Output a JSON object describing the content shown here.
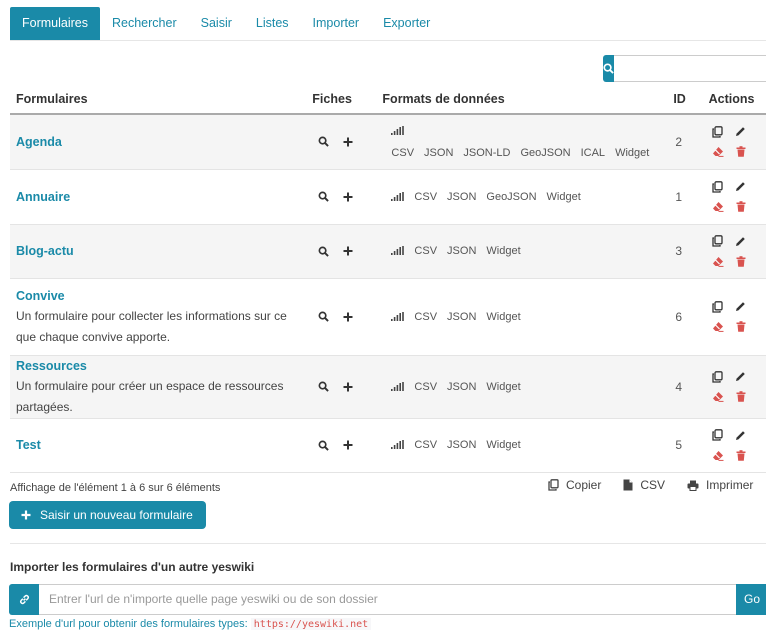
{
  "tabs": [
    "Formulaires",
    "Rechercher",
    "Saisir",
    "Listes",
    "Importer",
    "Exporter"
  ],
  "active_tab": 0,
  "search": {
    "value": ""
  },
  "table": {
    "headers": {
      "name": "Formulaires",
      "fiches": "Fiches",
      "formats": "Formats de données",
      "id": "ID",
      "actions": "Actions"
    },
    "rows": [
      {
        "name": "Agenda",
        "desc": "",
        "formats": [
          "CSV",
          "JSON",
          "JSON-LD",
          "GeoJSON",
          "ICAL",
          "Widget"
        ],
        "id": "2"
      },
      {
        "name": "Annuaire",
        "desc": "",
        "formats": [
          "CSV",
          "JSON",
          "GeoJSON",
          "Widget"
        ],
        "id": "1"
      },
      {
        "name": "Blog-actu",
        "desc": "",
        "formats": [
          "CSV",
          "JSON",
          "Widget"
        ],
        "id": "3"
      },
      {
        "name": "Convive",
        "desc": "Un formulaire pour collecter les informations sur ce que chaque convive apporte.",
        "formats": [
          "CSV",
          "JSON",
          "Widget"
        ],
        "id": "6"
      },
      {
        "name": "Ressources",
        "desc": "Un formulaire pour créer un espace de ressources partagées.",
        "formats": [
          "CSV",
          "JSON",
          "Widget"
        ],
        "id": "4"
      },
      {
        "name": "Test",
        "desc": "",
        "formats": [
          "CSV",
          "JSON",
          "Widget"
        ],
        "id": "5"
      }
    ]
  },
  "info": "Affichage de l'élément 1 à 6 sur 6 éléments",
  "export": {
    "copy": "Copier",
    "csv": "CSV",
    "print": "Imprimer"
  },
  "new_button": "Saisir un nouveau formulaire",
  "import": {
    "title": "Importer les formulaires d'un autre yeswiki",
    "placeholder": "Entrer l'url de n'importe quelle page yeswiki ou de son dossier",
    "go": "Go",
    "example_text": "Exemple d'url pour obtenir des formulaires types:",
    "example_url": "https://yeswiki.net"
  },
  "colors": {
    "accent": "#1a8aa8",
    "danger": "#d9534f"
  }
}
